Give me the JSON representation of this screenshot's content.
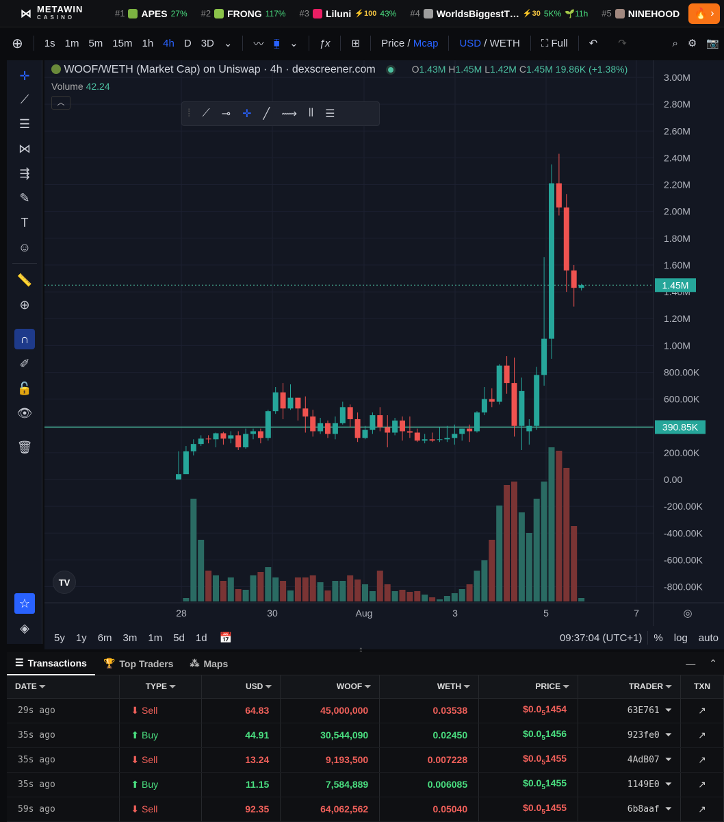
{
  "ticker": {
    "brand": "METAWIN",
    "brand_sub": "CASINO",
    "items": [
      {
        "rank": "#1",
        "name": "APES",
        "pct": "27%",
        "boost": "",
        "color": "#7cb342"
      },
      {
        "rank": "#2",
        "name": "FRONG",
        "pct": "117%",
        "boost": "",
        "color": "#8bc34a"
      },
      {
        "rank": "#3",
        "name": "Liluni",
        "pct": "43%",
        "boost": "⚡100",
        "color": "#e91e63"
      },
      {
        "rank": "#4",
        "name": "WorldsBiggestT…",
        "pct": "5K%",
        "boost": "⚡30",
        "extra": "🌱11h",
        "color": "#9e9e9e"
      },
      {
        "rank": "#5",
        "name": "NINEHOOD",
        "pct": "",
        "boost": "",
        "color": "#a1887f"
      }
    ]
  },
  "toolbar": {
    "intervals": [
      "1s",
      "1m",
      "5m",
      "15m",
      "1h",
      "4h",
      "D",
      "3D"
    ],
    "active_interval": "4h",
    "price": "Price",
    "mcap": "Mcap",
    "usd": "USD",
    "weth": "WETH",
    "full": "Full"
  },
  "legend": {
    "title": "WOOF/WETH (Market Cap) on Uniswap · 4h · dexscreener.com",
    "o": "1.43M",
    "h": "1.45M",
    "l": "1.42M",
    "c": "1.45M",
    "change": "19.86K (+1.38%)",
    "volume_label": "Volume",
    "volume_value": "42.24"
  },
  "chart_data": {
    "type": "candlestick",
    "y_ticks": [
      "3.00M",
      "2.80M",
      "2.60M",
      "2.40M",
      "2.20M",
      "2.00M",
      "1.80M",
      "1.60M",
      "1.40M",
      "1.20M",
      "1.00M",
      "800.00K",
      "600.00K",
      "400.00K",
      "200.00K",
      "0.00",
      "-200.00K",
      "-400.00K",
      "-600.00K",
      "-800.00K"
    ],
    "x_ticks": [
      "28",
      "30",
      "Aug",
      "3",
      "5",
      "7"
    ],
    "last_price_label": "1.45M",
    "hline_label": "390.85K",
    "hline_value": 390850,
    "last_price": 1450000,
    "candles": [
      [
        0,
        40,
        40,
        210,
        0
      ],
      [
        40,
        210,
        160,
        250,
        0
      ],
      [
        210,
        265,
        180,
        300,
        0
      ],
      [
        265,
        305,
        250,
        330,
        0
      ],
      [
        305,
        300,
        270,
        330,
        0
      ],
      [
        300,
        345,
        240,
        350,
        0
      ],
      [
        345,
        305,
        260,
        355,
        0
      ],
      [
        305,
        330,
        270,
        360,
        0
      ],
      [
        330,
        240,
        220,
        360,
        0
      ],
      [
        240,
        340,
        230,
        380,
        0
      ],
      [
        340,
        360,
        300,
        380,
        0
      ],
      [
        360,
        310,
        270,
        380,
        0
      ],
      [
        310,
        510,
        290,
        520,
        0
      ],
      [
        510,
        650,
        490,
        690,
        0
      ],
      [
        650,
        530,
        450,
        720,
        0
      ],
      [
        530,
        610,
        520,
        710,
        0
      ],
      [
        610,
        530,
        440,
        610,
        0
      ],
      [
        530,
        470,
        350,
        620,
        0
      ],
      [
        470,
        360,
        320,
        520,
        0
      ],
      [
        360,
        420,
        340,
        460,
        0
      ],
      [
        420,
        340,
        310,
        440,
        0
      ],
      [
        340,
        420,
        300,
        470,
        0
      ],
      [
        420,
        540,
        410,
        580,
        0
      ],
      [
        540,
        450,
        390,
        560,
        0
      ],
      [
        450,
        310,
        280,
        500,
        0
      ],
      [
        310,
        370,
        300,
        400,
        0
      ],
      [
        370,
        480,
        340,
        500,
        0
      ],
      [
        480,
        390,
        360,
        540,
        0
      ],
      [
        390,
        350,
        240,
        480,
        0
      ],
      [
        350,
        440,
        330,
        460,
        0
      ],
      [
        440,
        360,
        290,
        470,
        0
      ],
      [
        360,
        350,
        310,
        470,
        0
      ],
      [
        350,
        290,
        280,
        380,
        0
      ],
      [
        290,
        300,
        270,
        340,
        0
      ],
      [
        300,
        290,
        280,
        350,
        0
      ],
      [
        300,
        300,
        280,
        390,
        0
      ],
      [
        300,
        310,
        280,
        400,
        0
      ],
      [
        310,
        340,
        260,
        410,
        0
      ],
      [
        340,
        380,
        290,
        380,
        0
      ],
      [
        380,
        360,
        280,
        410,
        0
      ],
      [
        360,
        500,
        350,
        510,
        0
      ],
      [
        500,
        600,
        480,
        690,
        0
      ],
      [
        600,
        580,
        540,
        680,
        0
      ],
      [
        580,
        850,
        560,
        860,
        0
      ],
      [
        850,
        720,
        640,
        920,
        0
      ],
      [
        720,
        400,
        320,
        910,
        0
      ],
      [
        400,
        660,
        220,
        760,
        0
      ],
      [
        360,
        400,
        260,
        450,
        0
      ],
      [
        400,
        780,
        370,
        840,
        0
      ],
      [
        780,
        1050,
        700,
        1660,
        0
      ],
      [
        1050,
        2210,
        900,
        2350,
        0
      ],
      [
        2210,
        2030,
        1970,
        2430,
        0
      ],
      [
        2030,
        1560,
        1400,
        2130,
        0
      ],
      [
        1560,
        1430,
        1290,
        1600,
        0
      ],
      [
        1430,
        1450,
        1410,
        1460,
        0
      ]
    ],
    "volumes": [
      0,
      5,
      150,
      90,
      45,
      38,
      30,
      35,
      18,
      17,
      38,
      43,
      50,
      35,
      30,
      16,
      35,
      35,
      38,
      28,
      16,
      30,
      30,
      38,
      32,
      25,
      15,
      45,
      25,
      15,
      17,
      14,
      15,
      10,
      6,
      3,
      8,
      12,
      18,
      25,
      45,
      60,
      90,
      140,
      170,
      175,
      130,
      100,
      150,
      175,
      225,
      220,
      195,
      110,
      5
    ],
    "bull": "#26a69a",
    "bear": "#ef5350",
    "vol_bull": "#2a6b63",
    "vol_bear": "#7a3434"
  },
  "chart_footer": {
    "ranges": [
      "5y",
      "1y",
      "6m",
      "3m",
      "1m",
      "5d",
      "1d"
    ],
    "time": "09:37:04 (UTC+1)",
    "pct": "%",
    "log": "log",
    "auto": "auto"
  },
  "panel": {
    "tabs": [
      "Transactions",
      "Top Traders",
      "Maps"
    ],
    "headers": [
      "DATE",
      "TYPE",
      "USD",
      "WOOF",
      "WETH",
      "PRICE",
      "TRADER",
      "TXN"
    ],
    "rows": [
      {
        "date": "29s ago",
        "type": "Sell",
        "usd": "64.83",
        "woof": "45,000,000",
        "weth": "0.03538",
        "price_a": "$0.0",
        "price_sub": "5",
        "price_b": "1454",
        "trader": "63E761"
      },
      {
        "date": "35s ago",
        "type": "Buy",
        "usd": "44.91",
        "woof": "30,544,090",
        "weth": "0.02450",
        "price_a": "$0.0",
        "price_sub": "5",
        "price_b": "1456",
        "trader": "923fe0"
      },
      {
        "date": "35s ago",
        "type": "Sell",
        "usd": "13.24",
        "woof": "9,193,500",
        "weth": "0.007228",
        "price_a": "$0.0",
        "price_sub": "5",
        "price_b": "1455",
        "trader": "4AdB07"
      },
      {
        "date": "35s ago",
        "type": "Buy",
        "usd": "11.15",
        "woof": "7,584,889",
        "weth": "0.006085",
        "price_a": "$0.0",
        "price_sub": "5",
        "price_b": "1455",
        "trader": "1149E0"
      },
      {
        "date": "59s ago",
        "type": "Sell",
        "usd": "92.35",
        "woof": "64,062,562",
        "weth": "0.05040",
        "price_a": "$0.0",
        "price_sub": "5",
        "price_b": "1455",
        "trader": "6b8aaf"
      }
    ]
  }
}
